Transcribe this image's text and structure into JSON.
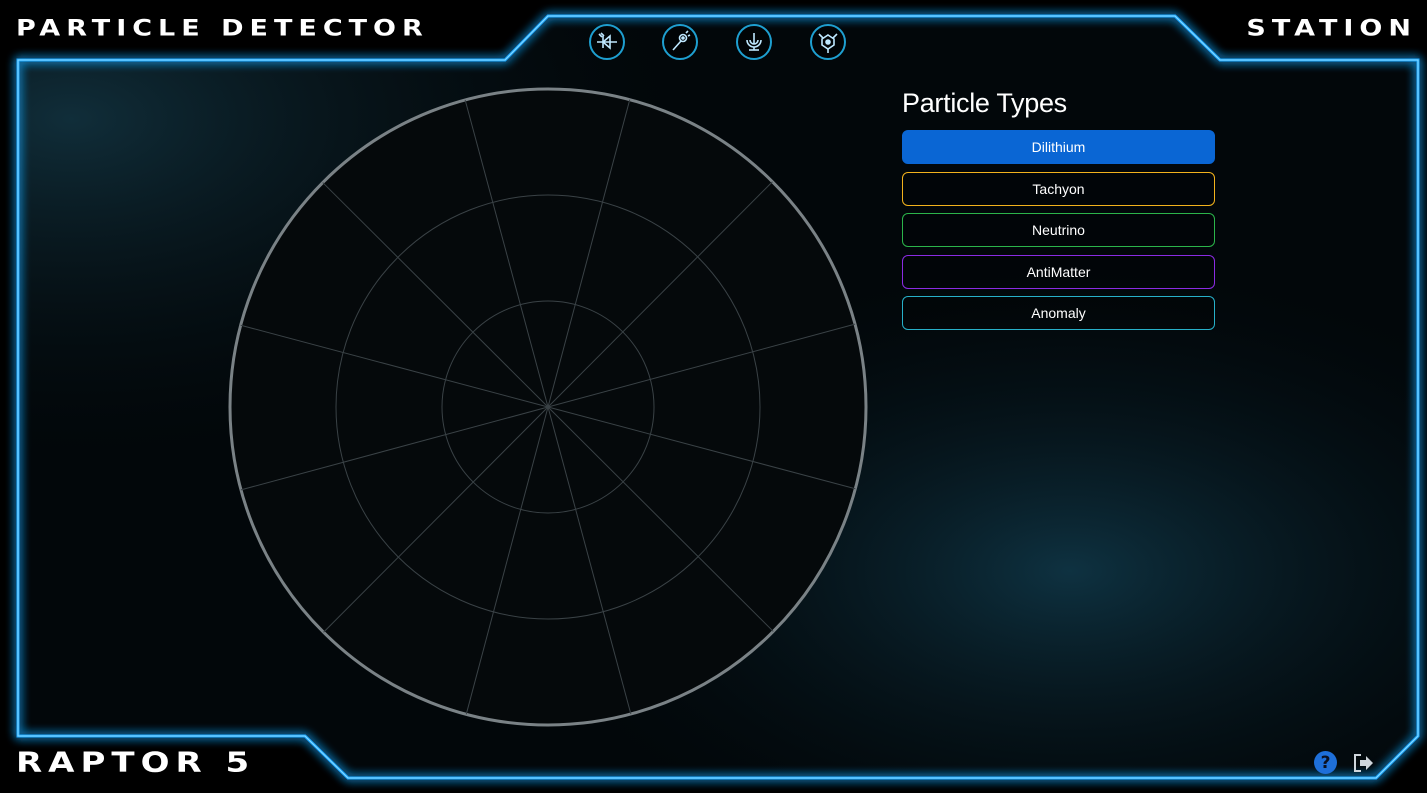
{
  "header": {
    "title_left": "PARTICLE DETECTOR",
    "title_right": "STATION",
    "nav_icons": [
      "diode-icon",
      "wrench-icon",
      "comms-icon",
      "sensor-icon"
    ]
  },
  "footer": {
    "title": "RAPTOR 5",
    "help_label": "?",
    "help_icon": "question-icon",
    "logout_icon": "logout-icon"
  },
  "panel": {
    "title": "Particle Types",
    "types": [
      {
        "label": "Dilithium",
        "color": "#0a6dd6",
        "active": true
      },
      {
        "label": "Tachyon",
        "color": "#f2b21c",
        "active": false
      },
      {
        "label": "Neutrino",
        "color": "#2bb44a",
        "active": false
      },
      {
        "label": "AntiMatter",
        "color": "#8a2be2",
        "active": false
      },
      {
        "label": "Anomaly",
        "color": "#27b0c8",
        "active": false
      }
    ]
  },
  "colors": {
    "frame_glow": "#1ea8ff",
    "accent": "#1e9fd0",
    "active_fill": "#0a66d4"
  },
  "radar": {
    "rings": 3,
    "spokes": 12
  }
}
